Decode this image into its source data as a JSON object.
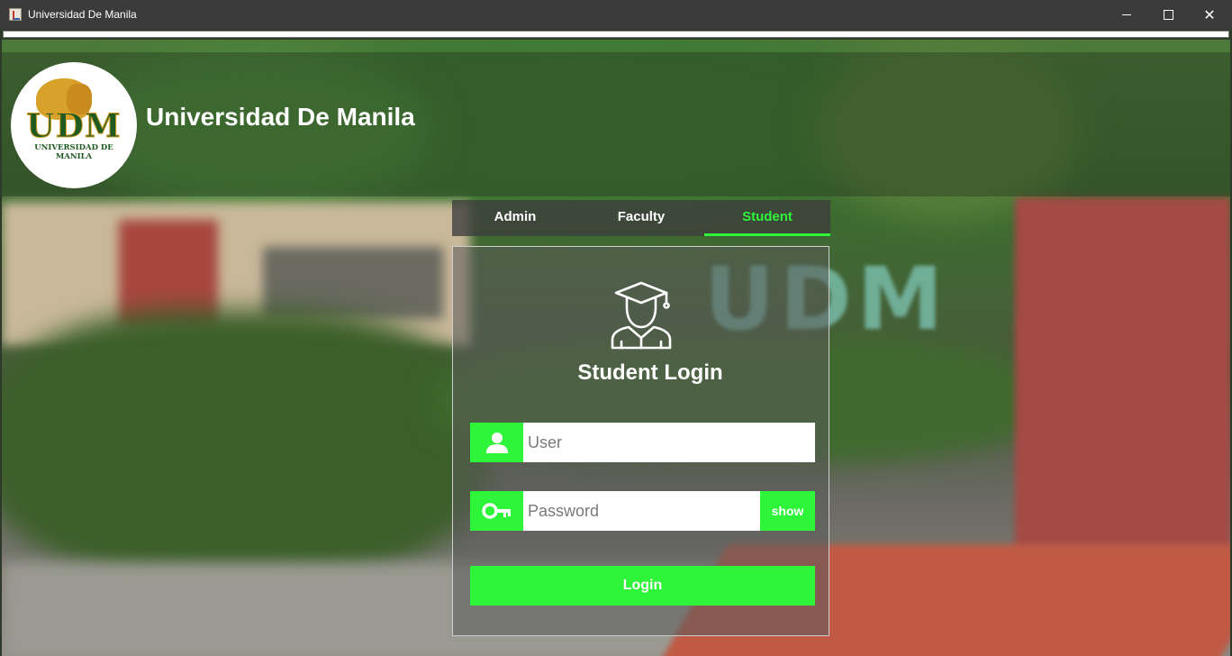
{
  "window": {
    "title": "Universidad De Manila",
    "controls": [
      "minimize",
      "maximize",
      "close"
    ]
  },
  "header": {
    "logo_text": "UDM",
    "logo_ribbon": "UNIVERSIDAD DE MANILA",
    "app_name": "Universidad De Manila"
  },
  "tabs": [
    {
      "label": "Admin",
      "active": false
    },
    {
      "label": "Faculty",
      "active": false
    },
    {
      "label": "Student",
      "active": true
    }
  ],
  "login": {
    "icon": "student-graduate-icon",
    "title": "Student Login",
    "user_placeholder": "User",
    "user_icon": "user-icon",
    "password_placeholder": "Password",
    "password_icon": "key-icon",
    "show_label": "show",
    "login_label": "Login"
  },
  "background_sign": "UDM",
  "colors": {
    "accent": "#2ef53a",
    "titlebar": "#3b3b3b"
  }
}
